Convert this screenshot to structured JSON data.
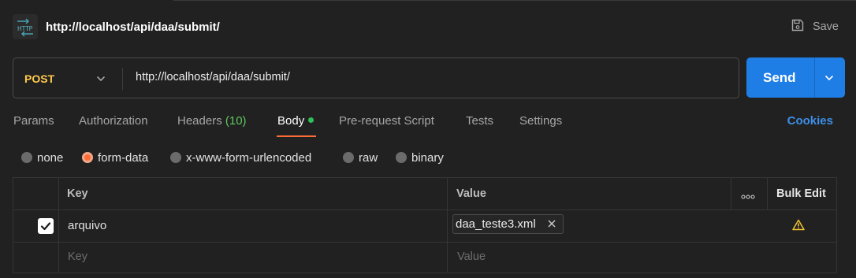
{
  "request": {
    "title": "http://localhost/api/daa/submit/",
    "method": "POST",
    "url": "http://localhost/api/daa/submit/"
  },
  "toolbar": {
    "save_label": "Save",
    "send_label": "Send"
  },
  "tabs": {
    "params": "Params",
    "authorization": "Authorization",
    "headers": "Headers",
    "headers_count": "(10)",
    "body": "Body",
    "prerequest": "Pre-request Script",
    "tests": "Tests",
    "settings": "Settings",
    "cookies": "Cookies",
    "active": "Body"
  },
  "body_types": {
    "none": "none",
    "form_data": "form-data",
    "urlencoded": "x-www-form-urlencoded",
    "raw": "raw",
    "binary": "binary",
    "selected": "form-data"
  },
  "table": {
    "headers": {
      "key": "Key",
      "value": "Value",
      "bulk_edit": "Bulk Edit"
    },
    "rows": [
      {
        "checked": true,
        "key": "arquivo",
        "value": "daa_teste3.xml"
      }
    ],
    "placeholder": {
      "key": "Key",
      "value": "Value"
    }
  },
  "colors": {
    "background": "#212121",
    "method": "#ffc94d",
    "send": "#1f7ee6",
    "accent": "#ff6c37",
    "link": "#3d8fe8",
    "count": "#5fc95f",
    "warning": "#f2c230"
  },
  "icons": {
    "http": "http-icon",
    "save": "save-icon",
    "method_dropdown": "chevron-down-icon",
    "send_dropdown": "chevron-down-icon",
    "more": "more-horizontal-icon",
    "remove_file": "close-icon",
    "warning": "warning-icon",
    "check": "check-icon"
  }
}
